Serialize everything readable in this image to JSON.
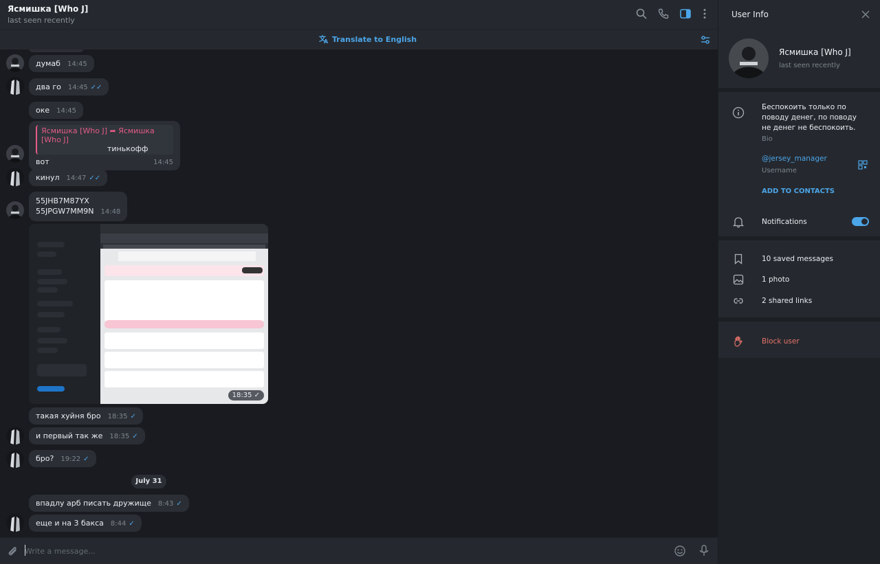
{
  "header": {
    "title": "Ясмишка [Who J]",
    "status": "last seen recently",
    "translate_label": "Translate to English"
  },
  "messages": [
    {
      "text": "думаб",
      "time": "14:45"
    },
    {
      "text": "два го",
      "time": "14:45"
    },
    {
      "text": "оке",
      "time": "14:45"
    },
    {
      "reply_name": "Ясмишка [Who J] ➦ Ясмишка [Who J]",
      "reply_text": "тинькофф",
      "text": "вот",
      "time": "14:45"
    },
    {
      "text": "кинул",
      "time": "14:47"
    },
    {
      "text_line1": "55JHB7M87YX",
      "text_line2": "55JPGW7MM9N",
      "time": "14:48"
    },
    {
      "photo_time": "18:35"
    },
    {
      "text": "такая хуйня бро",
      "time": "18:35"
    },
    {
      "text": "и первый так же",
      "time": "18:35"
    },
    {
      "text": "бро?",
      "time": "19:22"
    },
    {
      "text": "впадлу арб писать дружище",
      "time": "8:43"
    },
    {
      "text": "еще и на 3 бакса",
      "time": "8:44"
    }
  ],
  "date_separator": "July 31",
  "composer": {
    "placeholder": "Write a message..."
  },
  "info": {
    "title": "User Info",
    "name": "Ясмишка [Who J]",
    "status": "last seen recently",
    "bio": "Беспокоить только по поводу денег, по поводу не денег не беспокоить.",
    "bio_label": "Bio",
    "username": "@jersey_manager",
    "username_label": "Username",
    "add_contacts": "ADD TO CONTACTS",
    "notifications": "Notifications",
    "saved_messages": "10 saved messages",
    "photos": "1 photo",
    "shared_links": "2 shared links",
    "block_user": "Block user"
  },
  "colors": {
    "accent": "#4ca5e8",
    "danger": "#e5736a",
    "reply": "#e35c84"
  }
}
